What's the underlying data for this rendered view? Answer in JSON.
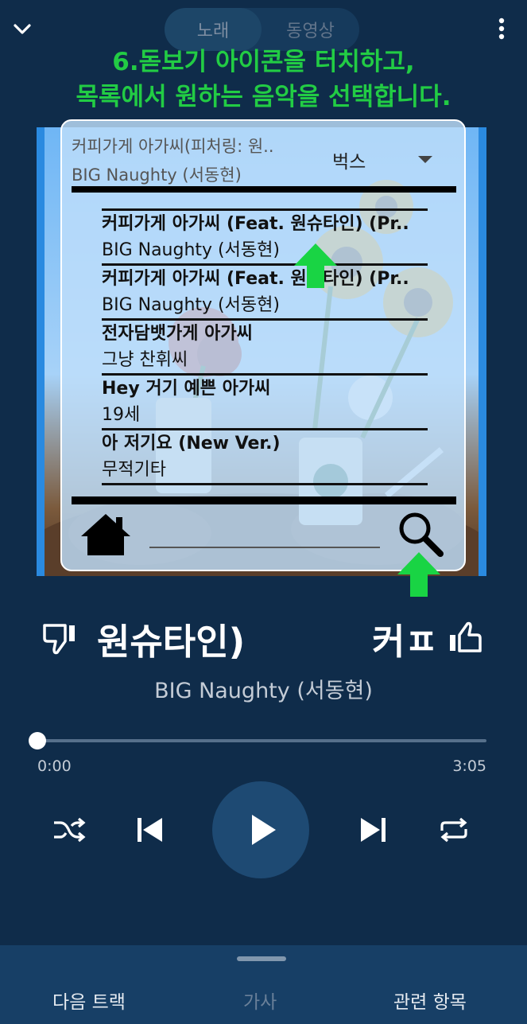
{
  "header": {
    "tabs": [
      {
        "label": "노래",
        "active": true
      },
      {
        "label": "동영상",
        "active": false
      }
    ]
  },
  "instruction": {
    "line1": "6.돋보기 아이콘을 터치하고,",
    "line2": "목록에서 원하는 음악을 선택합니다."
  },
  "overlay": {
    "current_title": "커피가게 아가씨(피처링: 원..",
    "current_artist": "BIG Naughty (서동현)",
    "provider": "벅스",
    "results": [
      {
        "title": "커피가게 아가씨 (Feat. 원슈타인) (Pr..",
        "artist": "BIG Naughty (서동현)"
      },
      {
        "title": "커피가게 아가씨 (Feat. 원슈타인) (Pr..",
        "artist": "BIG Naughty (서동현)"
      },
      {
        "title": "전자담뱃가게 아가씨",
        "artist": "그냥 찬휘씨"
      },
      {
        "title": "Hey 거기 예쁜 아가씨",
        "artist": "19세"
      },
      {
        "title": "아 저기요 (New Ver.)",
        "artist": "무적기타"
      }
    ],
    "icons": {
      "home": "home-icon",
      "search": "search-icon"
    }
  },
  "now_playing": {
    "title_left": "원슈타인)",
    "title_right": "커ㅍ",
    "artist": "BIG Naughty (서동현)",
    "current_time": "0:00",
    "total_time": "3:05",
    "progress": 0
  },
  "bottom_tabs": [
    {
      "label": "다음 트랙",
      "enabled": true
    },
    {
      "label": "가사",
      "enabled": false
    },
    {
      "label": "관련 항목",
      "enabled": true
    }
  ],
  "colors": {
    "background": "#0f2c4a",
    "instruction": "#22cc44",
    "pointer_arrow": "#19d444",
    "bottom_bar": "#173f66"
  }
}
